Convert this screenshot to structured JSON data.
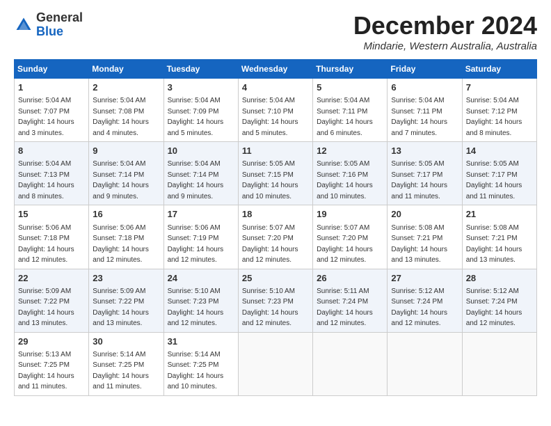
{
  "header": {
    "logo_general": "General",
    "logo_blue": "Blue",
    "month_title": "December 2024",
    "location": "Mindarie, Western Australia, Australia"
  },
  "days_of_week": [
    "Sunday",
    "Monday",
    "Tuesday",
    "Wednesday",
    "Thursday",
    "Friday",
    "Saturday"
  ],
  "weeks": [
    [
      {
        "day": "1",
        "sunrise": "5:04 AM",
        "sunset": "7:07 PM",
        "daylight": "14 hours and 3 minutes."
      },
      {
        "day": "2",
        "sunrise": "5:04 AM",
        "sunset": "7:08 PM",
        "daylight": "14 hours and 4 minutes."
      },
      {
        "day": "3",
        "sunrise": "5:04 AM",
        "sunset": "7:09 PM",
        "daylight": "14 hours and 5 minutes."
      },
      {
        "day": "4",
        "sunrise": "5:04 AM",
        "sunset": "7:10 PM",
        "daylight": "14 hours and 5 minutes."
      },
      {
        "day": "5",
        "sunrise": "5:04 AM",
        "sunset": "7:11 PM",
        "daylight": "14 hours and 6 minutes."
      },
      {
        "day": "6",
        "sunrise": "5:04 AM",
        "sunset": "7:11 PM",
        "daylight": "14 hours and 7 minutes."
      },
      {
        "day": "7",
        "sunrise": "5:04 AM",
        "sunset": "7:12 PM",
        "daylight": "14 hours and 8 minutes."
      }
    ],
    [
      {
        "day": "8",
        "sunrise": "5:04 AM",
        "sunset": "7:13 PM",
        "daylight": "14 hours and 8 minutes."
      },
      {
        "day": "9",
        "sunrise": "5:04 AM",
        "sunset": "7:14 PM",
        "daylight": "14 hours and 9 minutes."
      },
      {
        "day": "10",
        "sunrise": "5:04 AM",
        "sunset": "7:14 PM",
        "daylight": "14 hours and 9 minutes."
      },
      {
        "day": "11",
        "sunrise": "5:05 AM",
        "sunset": "7:15 PM",
        "daylight": "14 hours and 10 minutes."
      },
      {
        "day": "12",
        "sunrise": "5:05 AM",
        "sunset": "7:16 PM",
        "daylight": "14 hours and 10 minutes."
      },
      {
        "day": "13",
        "sunrise": "5:05 AM",
        "sunset": "7:17 PM",
        "daylight": "14 hours and 11 minutes."
      },
      {
        "day": "14",
        "sunrise": "5:05 AM",
        "sunset": "7:17 PM",
        "daylight": "14 hours and 11 minutes."
      }
    ],
    [
      {
        "day": "15",
        "sunrise": "5:06 AM",
        "sunset": "7:18 PM",
        "daylight": "14 hours and 12 minutes."
      },
      {
        "day": "16",
        "sunrise": "5:06 AM",
        "sunset": "7:18 PM",
        "daylight": "14 hours and 12 minutes."
      },
      {
        "day": "17",
        "sunrise": "5:06 AM",
        "sunset": "7:19 PM",
        "daylight": "14 hours and 12 minutes."
      },
      {
        "day": "18",
        "sunrise": "5:07 AM",
        "sunset": "7:20 PM",
        "daylight": "14 hours and 12 minutes."
      },
      {
        "day": "19",
        "sunrise": "5:07 AM",
        "sunset": "7:20 PM",
        "daylight": "14 hours and 12 minutes."
      },
      {
        "day": "20",
        "sunrise": "5:08 AM",
        "sunset": "7:21 PM",
        "daylight": "14 hours and 13 minutes."
      },
      {
        "day": "21",
        "sunrise": "5:08 AM",
        "sunset": "7:21 PM",
        "daylight": "14 hours and 13 minutes."
      }
    ],
    [
      {
        "day": "22",
        "sunrise": "5:09 AM",
        "sunset": "7:22 PM",
        "daylight": "14 hours and 13 minutes."
      },
      {
        "day": "23",
        "sunrise": "5:09 AM",
        "sunset": "7:22 PM",
        "daylight": "14 hours and 13 minutes."
      },
      {
        "day": "24",
        "sunrise": "5:10 AM",
        "sunset": "7:23 PM",
        "daylight": "14 hours and 12 minutes."
      },
      {
        "day": "25",
        "sunrise": "5:10 AM",
        "sunset": "7:23 PM",
        "daylight": "14 hours and 12 minutes."
      },
      {
        "day": "26",
        "sunrise": "5:11 AM",
        "sunset": "7:24 PM",
        "daylight": "14 hours and 12 minutes."
      },
      {
        "day": "27",
        "sunrise": "5:12 AM",
        "sunset": "7:24 PM",
        "daylight": "14 hours and 12 minutes."
      },
      {
        "day": "28",
        "sunrise": "5:12 AM",
        "sunset": "7:24 PM",
        "daylight": "14 hours and 12 minutes."
      }
    ],
    [
      {
        "day": "29",
        "sunrise": "5:13 AM",
        "sunset": "7:25 PM",
        "daylight": "14 hours and 11 minutes."
      },
      {
        "day": "30",
        "sunrise": "5:14 AM",
        "sunset": "7:25 PM",
        "daylight": "14 hours and 11 minutes."
      },
      {
        "day": "31",
        "sunrise": "5:14 AM",
        "sunset": "7:25 PM",
        "daylight": "14 hours and 10 minutes."
      },
      null,
      null,
      null,
      null
    ]
  ]
}
